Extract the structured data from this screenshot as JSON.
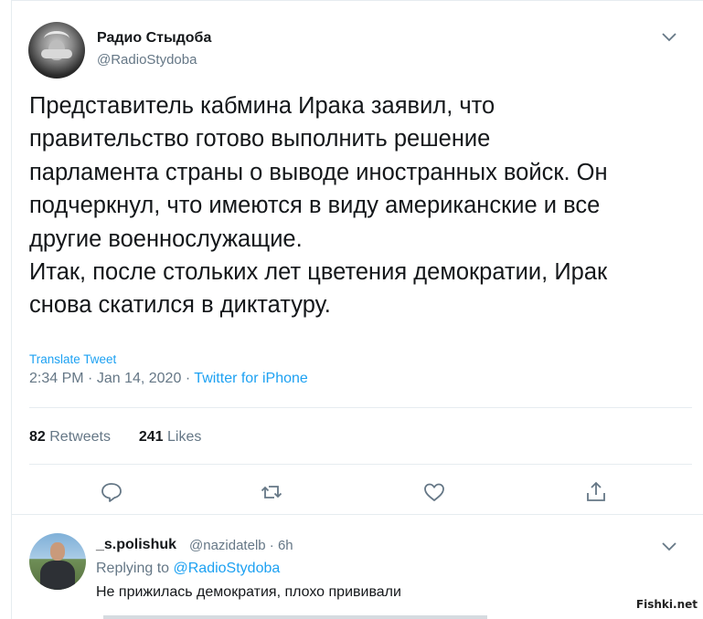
{
  "tweet": {
    "author_name": "Радио Стыдоба",
    "author_handle": "@RadioStydoba",
    "text": "Представитель кабмина Ирака заявил, что\nправительство готово выполнить решение\nпарламента страны о выводе иностранных войск. Он\nподчеркнул, что имеются в виду американские и все\nдругие военнослужащие.\nИтак, после стольких лет цветения демократии, Ирак\nснова скатился в диктатуру.",
    "translate_label": "Translate Tweet",
    "time": "2:34 PM",
    "date": "Jan 14, 2020",
    "source": "Twitter for iPhone",
    "retweets_count": "82",
    "retweets_label": "Retweets",
    "likes_count": "241",
    "likes_label": "Likes",
    "actions": [
      "reply-icon",
      "retweet-icon",
      "like-icon",
      "share-icon"
    ]
  },
  "reply": {
    "author_name": "_s.polishuk",
    "author_handle": "@nazidatelb",
    "time_ago": "6h",
    "replying_prefix": "Replying to",
    "replying_to": "@RadioStydoba",
    "text": "Не прижилась демократия, плохо прививали"
  },
  "watermark": "Fishki.net",
  "colors": {
    "accent": "#1da1f2",
    "muted": "#657786",
    "text": "#14171a",
    "border": "#e6ecf0"
  }
}
